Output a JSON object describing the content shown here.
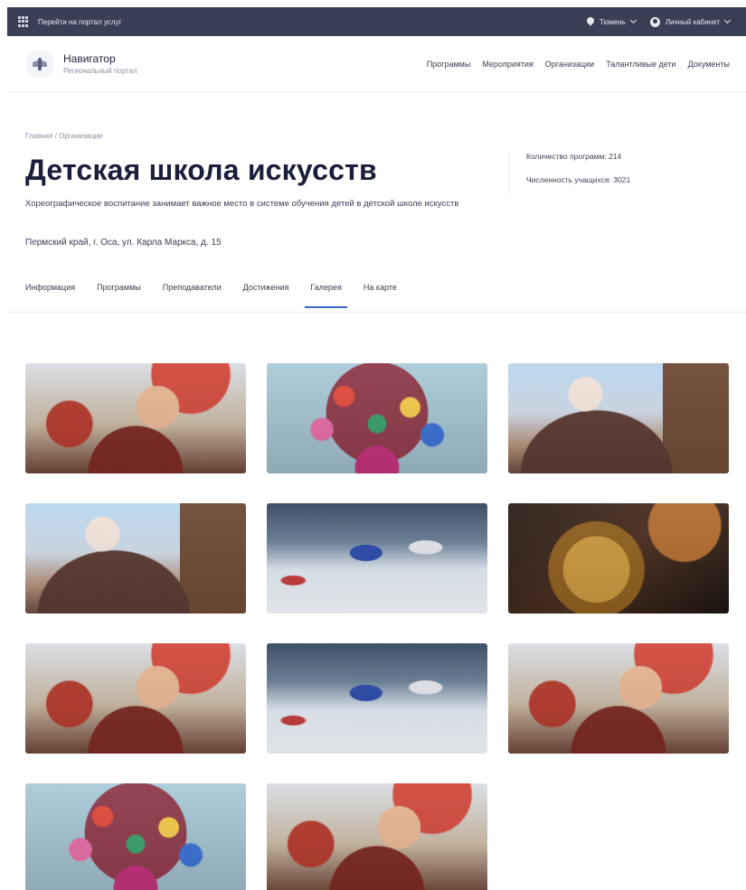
{
  "topbar": {
    "portal_link": "Перейти на портал услуг",
    "region": "Тюмень",
    "account": "Личный кабинет"
  },
  "header": {
    "brand_name": "Навигатор",
    "brand_sub": "Региональный портал",
    "nav": [
      "Программы",
      "Мероприятия",
      "Организации",
      "Талантливые дети",
      "Документы"
    ]
  },
  "breadcrumb": "Главная / Организации",
  "title": "Детская школа искусств",
  "description": "Хореографическое воспитание занимает важное место в системе обучения детей в детской школе искусств",
  "address": "Пермский край, г. Оса, ул. Карла Маркса, д. 15",
  "stats": {
    "programs": "Количество программ: 214",
    "students": "Численность учащихся: 3021"
  },
  "tabs": [
    "Информация",
    "Программы",
    "Преподаватели",
    "Достижения",
    "Галерея",
    "На карте"
  ],
  "active_tab": "Галерея",
  "gallery": [
    {
      "image": "festival-crowd-photo"
    },
    {
      "image": "flower-bouquet-photo"
    },
    {
      "image": "festival-tower-photo"
    },
    {
      "image": "festival-tower-photo"
    },
    {
      "image": "ski-race-photo"
    },
    {
      "image": "french-horn-photo"
    },
    {
      "image": "festival-crowd-photo"
    },
    {
      "image": "ski-race-photo"
    },
    {
      "image": "festival-crowd-photo"
    },
    {
      "image": "flower-bouquet-photo"
    },
    {
      "image": "festival-crowd-photo"
    }
  ],
  "colors": {
    "topbar_bg": "#3a3f55",
    "accent": "#3b64c8",
    "text_dark": "#1b1f3b",
    "text_muted": "#8a8fa6"
  }
}
